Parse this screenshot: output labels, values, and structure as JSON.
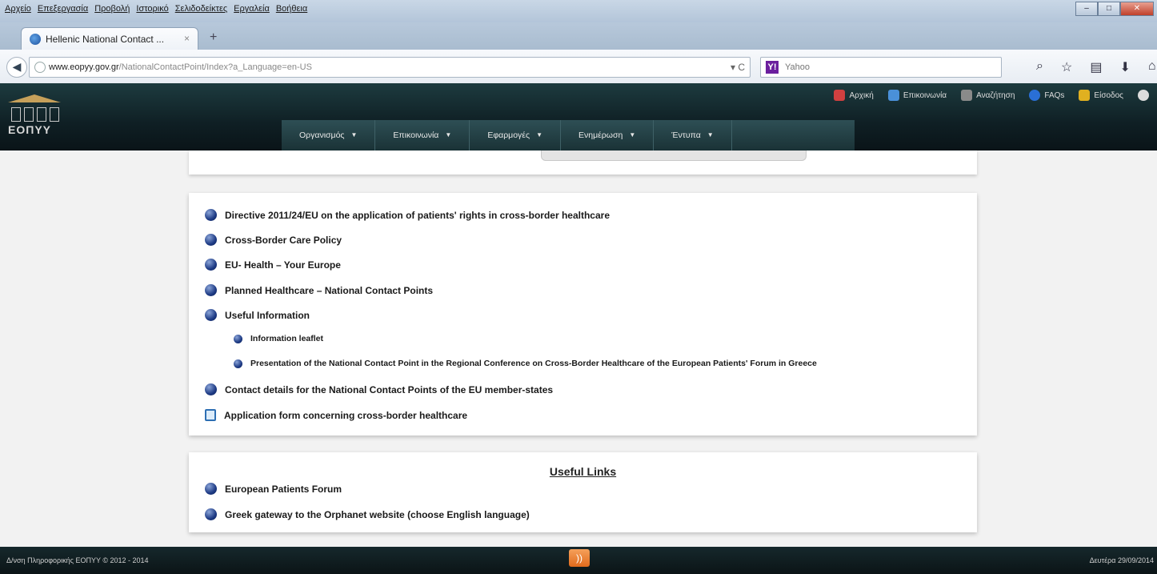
{
  "browser": {
    "menu": [
      "Αρχείο",
      "Επεξεργασία",
      "Προβολή",
      "Ιστορικό",
      "Σελιδοδείκτες",
      "Εργαλεία",
      "Βοήθεια"
    ],
    "window_controls": [
      "–",
      "□",
      "✕"
    ],
    "tab_title": "Hellenic National Contact ...",
    "tab_close": "×",
    "new_tab": "+",
    "url_host": "www.eopyy.gov.gr",
    "url_path": "/NationalContactPoint/Index?a_Language=en-US",
    "reload": "▾ C",
    "search_engine_icon": "Y!",
    "search_placeholder": "Yahoo",
    "toolbar_icons": [
      "search-icon",
      "star-icon",
      "bookmarks-icon",
      "download-icon",
      "home-icon",
      "menu-icon"
    ]
  },
  "site": {
    "logo_text": "ΕΟΠΥΥ",
    "top_links": [
      {
        "label": "Αρχική",
        "color": "#d04040"
      },
      {
        "label": "Επικοινωνία",
        "color": "#4a90d9"
      },
      {
        "label": "Αναζήτηση",
        "color": "#8a8a8a"
      },
      {
        "label": "FAQs",
        "color": "#2a6fd6"
      },
      {
        "label": "Είσοδος",
        "color": "#e0b020"
      }
    ],
    "nav": [
      "Οργανισμός",
      "Επικοινωνία",
      "Εφαρμογές",
      "Ενημέρωση",
      "Έντυπα"
    ]
  },
  "links_panel": {
    "items": [
      "Directive 2011/24/EU on the application of patients' rights in cross-border healthcare",
      "Cross-Border Care Policy",
      "EU- Health – Your Europe",
      "Planned Healthcare – National Contact Points",
      "Useful Information"
    ],
    "sub_items": [
      "Information leaflet",
      "Presentation of the National Contact Point in the Regional Conference on Cross-Border Healthcare of the European Patients' Forum in Greece"
    ],
    "contact_details": "Contact details for the National Contact Points of the EU member-states",
    "application_form": "Application form concerning cross-border healthcare"
  },
  "useful_links": {
    "title": "Useful Links",
    "items": [
      "European Patients Forum",
      "Greek gateway to the Orphanet website (choose English language)"
    ]
  },
  "footer": {
    "copyright": "Δ/νση Πληροφορικής ΕΟΠΥΥ © 2012 - 2014",
    "rss": "RSS",
    "date": "Δευτέρα 29/09/2014"
  }
}
